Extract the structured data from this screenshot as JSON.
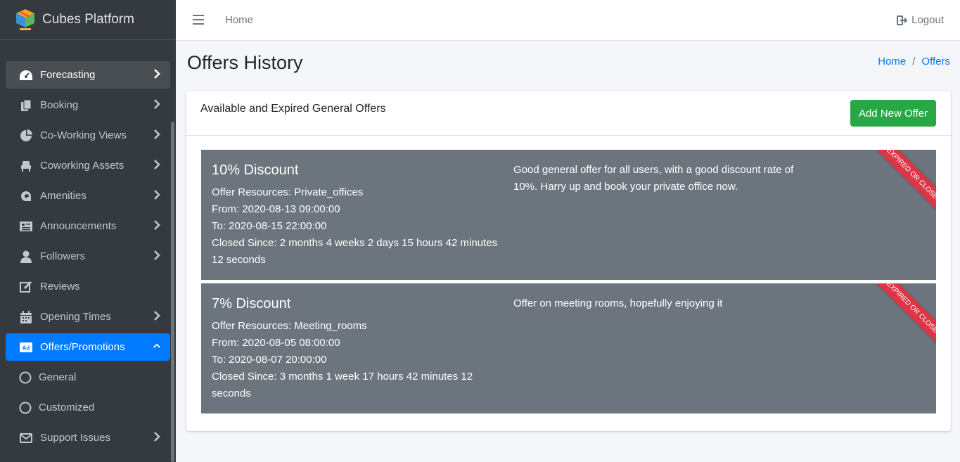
{
  "brand": {
    "name": "Cubes Platform"
  },
  "sidebar": {
    "items": [
      {
        "label": "Forecasting",
        "icon": "tachometer-icon"
      },
      {
        "label": "Booking",
        "icon": "copy-icon"
      },
      {
        "label": "Co-Working Views",
        "icon": "chart-pie-icon"
      },
      {
        "label": "Coworking Assets",
        "icon": "couch-icon"
      },
      {
        "label": "Amenities",
        "icon": "coffee-icon"
      },
      {
        "label": "Announcements",
        "icon": "newspaper-icon"
      },
      {
        "label": "Followers",
        "icon": "user-icon"
      },
      {
        "label": "Reviews",
        "icon": "edit-icon"
      },
      {
        "label": "Opening Times",
        "icon": "calendar-icon"
      },
      {
        "label": "Offers/Promotions",
        "icon": "ad-icon"
      },
      {
        "label": "General",
        "icon": "circle-icon"
      },
      {
        "label": "Customized",
        "icon": "circle-icon"
      },
      {
        "label": "Support Issues",
        "icon": "envelope-icon"
      }
    ]
  },
  "header": {
    "home": "Home",
    "logout": "Logout"
  },
  "page": {
    "title": "Offers History",
    "breadcrumb": [
      "Home",
      "Offers"
    ],
    "breadcrumb_sep": "/"
  },
  "card": {
    "title": "Available and Expired General Offers",
    "add_button": "Add New Offer",
    "offers": [
      {
        "name": "10% Discount",
        "resources": "Offer Resources: Private_offices",
        "from": "From: 2020-08-13 09:00:00",
        "to": "To: 2020-08-15 22:00:00",
        "closed": "Closed Since: 2 months 4 weeks 2 days 15 hours 42 minutes 12 seconds",
        "description": "Good general offer for all users, with a good discount rate of 10%. Harry up and book your private office now.",
        "ribbon": "Expired or Closed"
      },
      {
        "name": "7% Discount",
        "resources": "Offer Resources: Meeting_rooms",
        "from": "From: 2020-08-05 08:00:00",
        "to": "To: 2020-08-07 20:00:00",
        "closed": "Closed Since: 3 months 1 week 17 hours 42 minutes 12 seconds",
        "description": "Offer on meeting rooms, hopefully enjoying it",
        "ribbon": "Expired or Closed"
      }
    ]
  },
  "colors": {
    "sidebar_bg": "#343a40",
    "active": "#007bff",
    "success": "#28a745",
    "offer_bg": "#6c757d",
    "ribbon": "#dc3545"
  }
}
